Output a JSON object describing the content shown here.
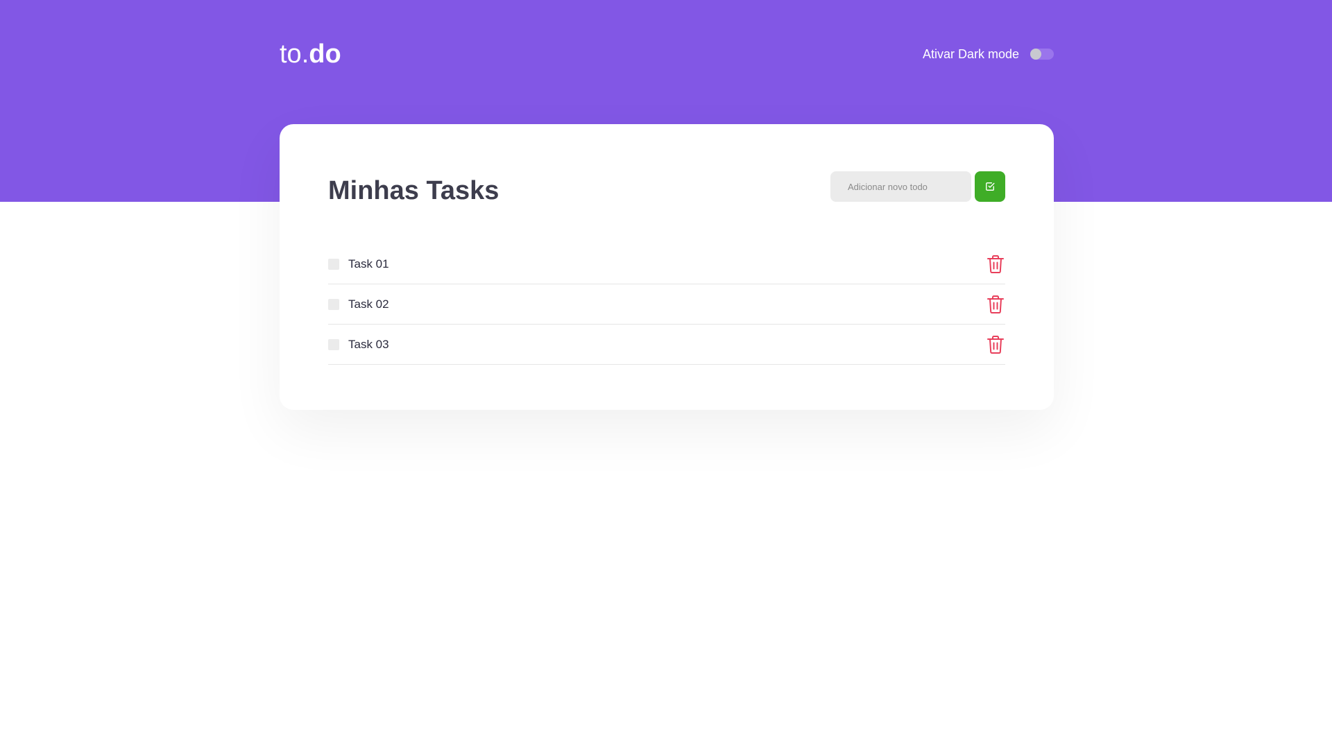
{
  "header": {
    "logo": {
      "part_to": "to",
      "part_dot": ".",
      "part_do": "do"
    },
    "dark_mode": {
      "label": "Ativar Dark mode",
      "enabled": false
    }
  },
  "card": {
    "title": "Minhas Tasks",
    "new_todo": {
      "placeholder": "Adicionar novo todo",
      "value": ""
    },
    "add_button_icon": "check-square-icon",
    "tasks": [
      {
        "label": "Task 01",
        "done": false,
        "delete_icon": "trash-icon"
      },
      {
        "label": "Task 02",
        "done": false,
        "delete_icon": "trash-icon"
      },
      {
        "label": "Task 03",
        "done": false,
        "delete_icon": "trash-icon"
      }
    ]
  },
  "colors": {
    "header_bg": "#8257e5",
    "title_text": "#3d3d4d",
    "add_button": "#3fad27",
    "delete_icon": "#e83f5b",
    "input_bg": "#ebebeb"
  }
}
